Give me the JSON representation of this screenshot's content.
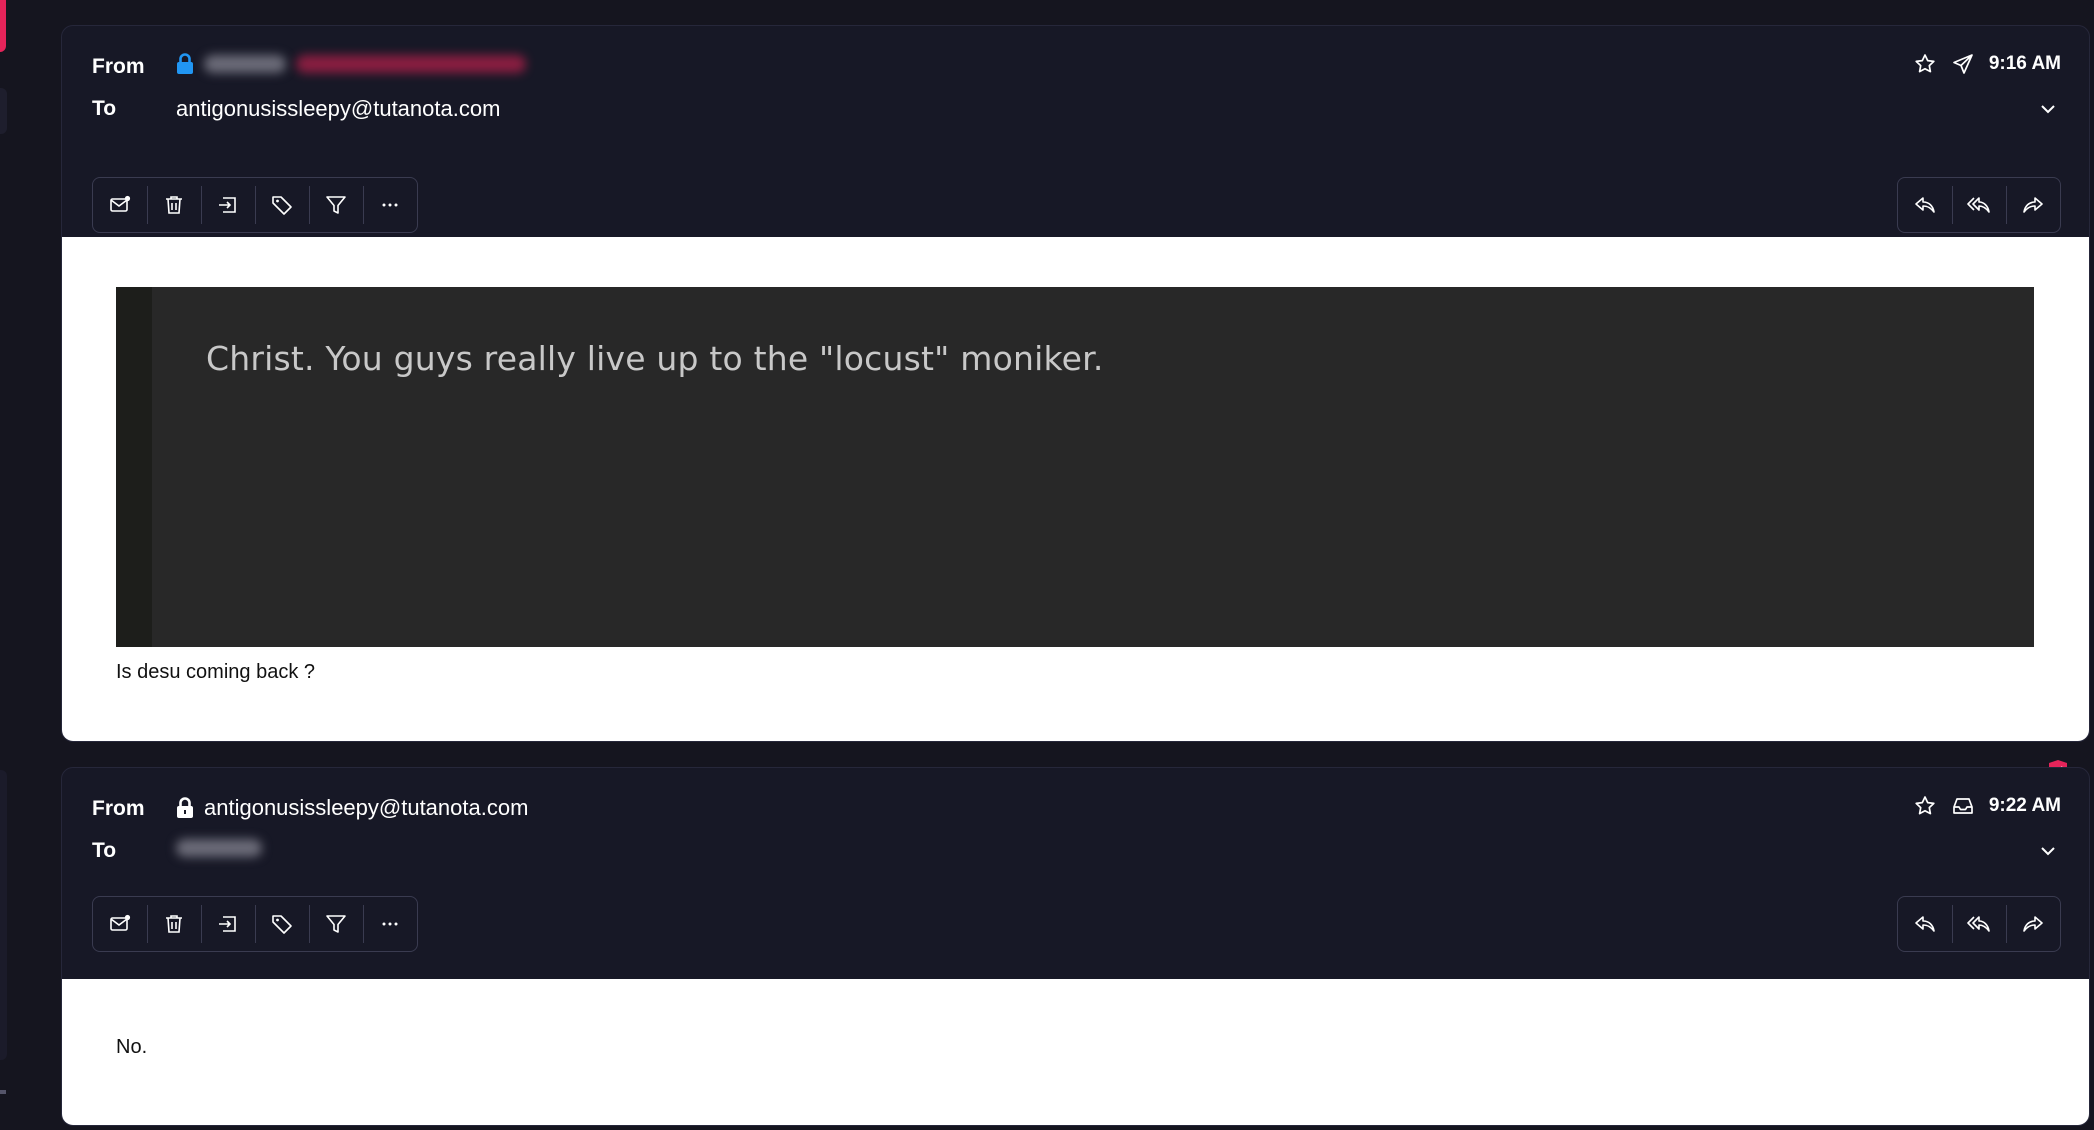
{
  "thread": [
    {
      "from_label": "From",
      "to_label": "To",
      "sender_name_blurred": "",
      "sender_address_blurred": "",
      "to_address": "antigonusissleepy@tutanota.com",
      "time": "9:16 AM",
      "status_icon": "sent-icon",
      "lock_color": "#2196f3",
      "body_quote": "Christ. You guys really live up to the \"locust\" moniker.",
      "body_text": "Is desu coming back ?"
    },
    {
      "from_label": "From",
      "to_label": "To",
      "from_address": "antigonusissleepy@tutanota.com",
      "to_address_blurred": "",
      "time": "9:22 AM",
      "status_icon": "inbox-icon",
      "body_text": "No."
    }
  ],
  "toolbar_icons": [
    "mark-unread-icon",
    "trash-icon",
    "move-icon",
    "label-icon",
    "filter-icon",
    "more-icon"
  ],
  "reply_icons": [
    "reply-icon",
    "reply-all-icon",
    "forward-icon"
  ],
  "colors": {
    "background": "#15151f",
    "card": "#171826",
    "accent": "#e5245a",
    "body": "#ffffff"
  }
}
